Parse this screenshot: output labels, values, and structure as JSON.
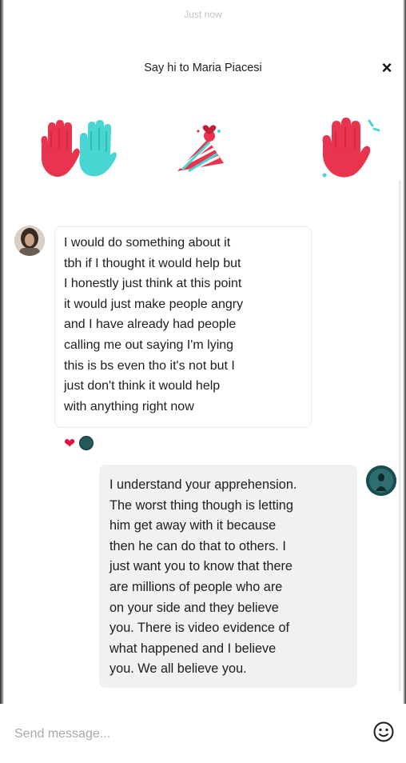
{
  "header": {
    "timestamp": "Just now",
    "prompt": "Say hi to Maria Piacesi",
    "close_symbol": "×"
  },
  "stickers": [
    {
      "icon": "raised-hands-sticker-icon"
    },
    {
      "icon": "party-hat-sticker-icon"
    },
    {
      "icon": "waving-hand-sticker-icon"
    }
  ],
  "colors": {
    "accent_red": "#e8344e",
    "accent_teal": "#47d6d2",
    "outgoing_bubble": "#f1f1f2",
    "heart": "#e2143f"
  },
  "messages": [
    {
      "direction": "incoming",
      "text": "I would do something about it\ntbh if I thought it would help but\nI honestly just think at this point\nit would just make people angry\nand I have already had people\ncalling me out saying I'm lying\nthis is bs even tho it's not but I\njust don't think it would help\nwith anything right now",
      "reactions": {
        "heart": "❤"
      }
    },
    {
      "direction": "outgoing",
      "text": "I understand your apprehension.\nThe worst thing though is letting\nhim get away with it because\nthen he can do that to others. I\njust want you to know that there\nare millions of people who are\non your side and they believe\nyou. There is video evidence of\nwhat happened and I believe\nyou. We all believe you."
    }
  ],
  "composer": {
    "placeholder": "Send message...",
    "value": ""
  }
}
